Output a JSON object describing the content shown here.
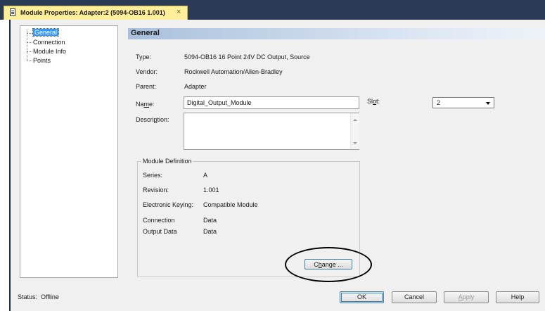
{
  "window": {
    "tab_title": "Module Properties: Adapter:2 (5094-OB16 1.001)",
    "tab_close": "×"
  },
  "tree": {
    "items": [
      {
        "label": "General",
        "selected": true
      },
      {
        "label": "Connection"
      },
      {
        "label": "Module Info"
      },
      {
        "label": "Points"
      }
    ]
  },
  "general": {
    "header": "General",
    "type_label": "Type:",
    "type_value": "5094-OB16 16 Point 24V DC Output, Source",
    "vendor_label": "Vendor:",
    "vendor_value": "Rockwell Automation/Allen-Bradley",
    "parent_label": "Parent:",
    "parent_value": "Adapter",
    "name_label_pre": "Na",
    "name_label_ul": "m",
    "name_label_post": "e:",
    "name_value": "Digital_Output_Module",
    "slot_label_pre": "Sl",
    "slot_label_ul": "o",
    "slot_label_post": "t:",
    "slot_value": "2",
    "description_label_pre": "Descri",
    "description_label_ul": "p",
    "description_label_post": "tion:",
    "description_value": ""
  },
  "module_definition": {
    "title": "Module Definition",
    "series_label": "Series:",
    "series_value": "A",
    "revision_label": "Revision:",
    "revision_value": "1.001",
    "keying_label": "Electronic Keying:",
    "keying_value": "Compatible Module",
    "connection_label": "Connection",
    "connection_value": "Data",
    "output_data_label": "Output Data",
    "output_data_value": "Data",
    "change_button_pre": "C",
    "change_button_ul": "h",
    "change_button_post": "ange ..."
  },
  "status": {
    "label": "Status:",
    "value": "Offline"
  },
  "buttons": {
    "ok": "OK",
    "cancel": "Cancel",
    "apply_ul": "A",
    "apply_post": "pply",
    "help": "Help"
  },
  "colors": {
    "title_bar": "#2b3a55",
    "tab": "#ffef9a",
    "selection": "#3399ff",
    "header_gradient_start": "#a9c0dc"
  }
}
